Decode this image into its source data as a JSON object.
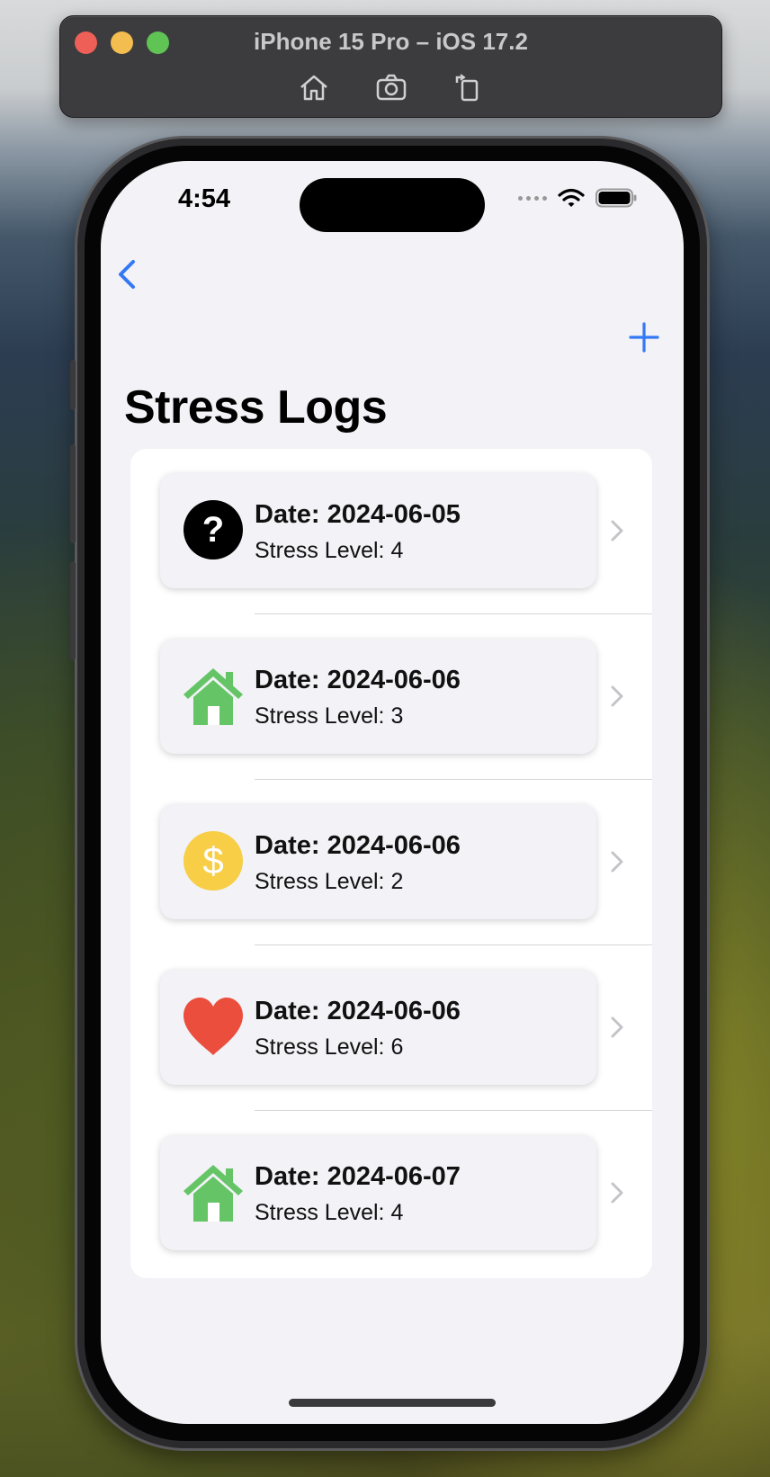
{
  "simulator": {
    "title": "iPhone 15 Pro – iOS 17.2",
    "tools": [
      "home-icon",
      "screenshot-icon",
      "rotate-icon"
    ]
  },
  "status_bar": {
    "time": "4:54",
    "icons": [
      "signal-dots-icon",
      "wifi-icon",
      "battery-icon"
    ]
  },
  "nav": {
    "back_icon": "chevron-left-icon",
    "add_icon": "plus-icon",
    "accent_color": "#3478f6"
  },
  "page": {
    "title": "Stress Logs"
  },
  "logs": [
    {
      "date": "Date: 2024-06-05",
      "level": "Stress Level: 4",
      "icon": "question-mark-circle-icon",
      "color": "#000000"
    },
    {
      "date": "Date: 2024-06-06",
      "level": "Stress Level: 3",
      "icon": "house-icon",
      "color": "#65c466"
    },
    {
      "date": "Date: 2024-06-06",
      "level": "Stress Level: 2",
      "icon": "dollar-coin-icon",
      "color": "#f7ce46"
    },
    {
      "date": "Date: 2024-06-06",
      "level": "Stress Level: 6",
      "icon": "heart-icon",
      "color": "#eb4e3d"
    },
    {
      "date": "Date: 2024-06-07",
      "level": "Stress Level: 4",
      "icon": "house-icon",
      "color": "#65c466"
    }
  ]
}
